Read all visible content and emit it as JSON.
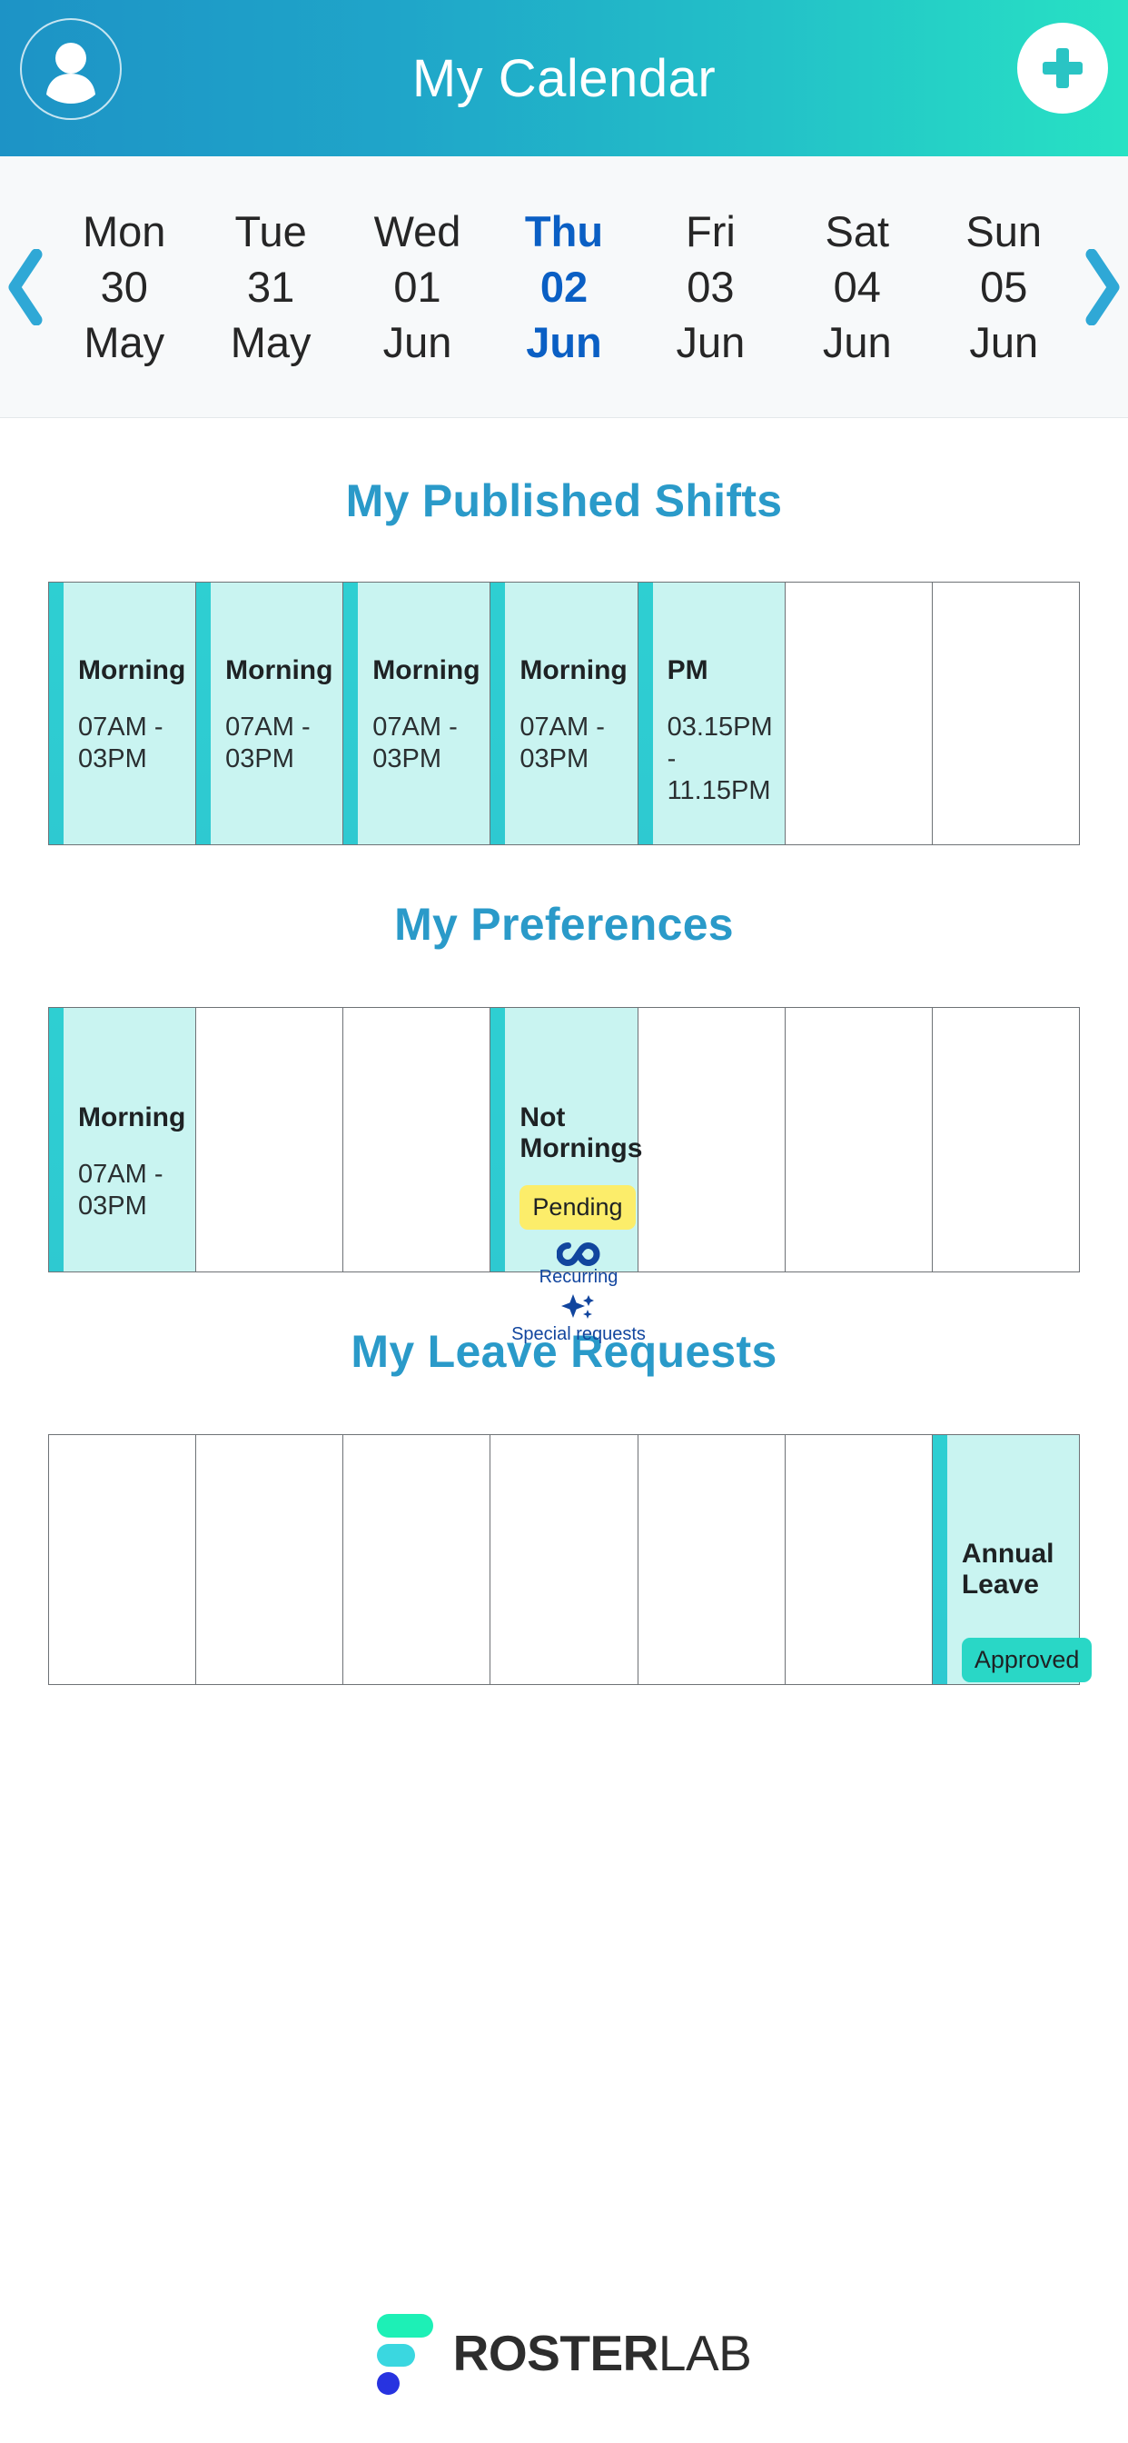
{
  "header": {
    "title": "My Calendar",
    "avatar_icon": "user-avatar-icon",
    "add_icon": "plus-circle-icon"
  },
  "datestrip": {
    "prev_icon": "chevron-left-icon",
    "next_icon": "chevron-right-icon",
    "days": [
      {
        "dow": "Mon",
        "num": "30",
        "mon": "May",
        "selected": false
      },
      {
        "dow": "Tue",
        "num": "31",
        "mon": "May",
        "selected": false
      },
      {
        "dow": "Wed",
        "num": "01",
        "mon": "Jun",
        "selected": false
      },
      {
        "dow": "Thu",
        "num": "02",
        "mon": "Jun",
        "selected": true
      },
      {
        "dow": "Fri",
        "num": "03",
        "mon": "Jun",
        "selected": false
      },
      {
        "dow": "Sat",
        "num": "04",
        "mon": "Jun",
        "selected": false
      },
      {
        "dow": "Sun",
        "num": "05",
        "mon": "Jun",
        "selected": false
      }
    ]
  },
  "sections": {
    "shifts_title": "My Published Shifts",
    "preferences_title": "My Preferences",
    "leave_title": "My Leave Requests"
  },
  "shifts": [
    {
      "title": "Morning",
      "time": "07AM - 03PM"
    },
    {
      "title": "Morning",
      "time": "07AM - 03PM"
    },
    {
      "title": "Morning",
      "time": "07AM - 03PM"
    },
    {
      "title": "Morning",
      "time": "07AM - 03PM"
    },
    {
      "title": "PM",
      "time": "03.15PM - 11.15PM"
    },
    null,
    null
  ],
  "preferences": [
    {
      "title": "Morning",
      "time": "07AM - 03PM"
    },
    null,
    null,
    {
      "title": "Not Mornings",
      "badge": "Pending",
      "meta": [
        {
          "icon": "infinity-icon",
          "label": "Recurring"
        },
        {
          "icon": "sparkle-icon",
          "label": "Special requests"
        }
      ]
    },
    null,
    null,
    null
  ],
  "leave": [
    null,
    null,
    null,
    null,
    null,
    null,
    {
      "title": "Annual Leave",
      "badge": "Approved"
    }
  ],
  "footer": {
    "logo_bold": "ROSTER",
    "logo_light": "LAB"
  },
  "colors": {
    "header_start": "#1d93c6",
    "header_end": "#27e2c4",
    "section_heading": "#2a9ac9",
    "selected_day": "#0a5fc4",
    "cell_fill": "#c9f4f1",
    "cell_accent": "#2ecfd2",
    "badge_pending": "#fced6a",
    "badge_approved": "#29d7c6",
    "meta_label": "#11459e"
  }
}
